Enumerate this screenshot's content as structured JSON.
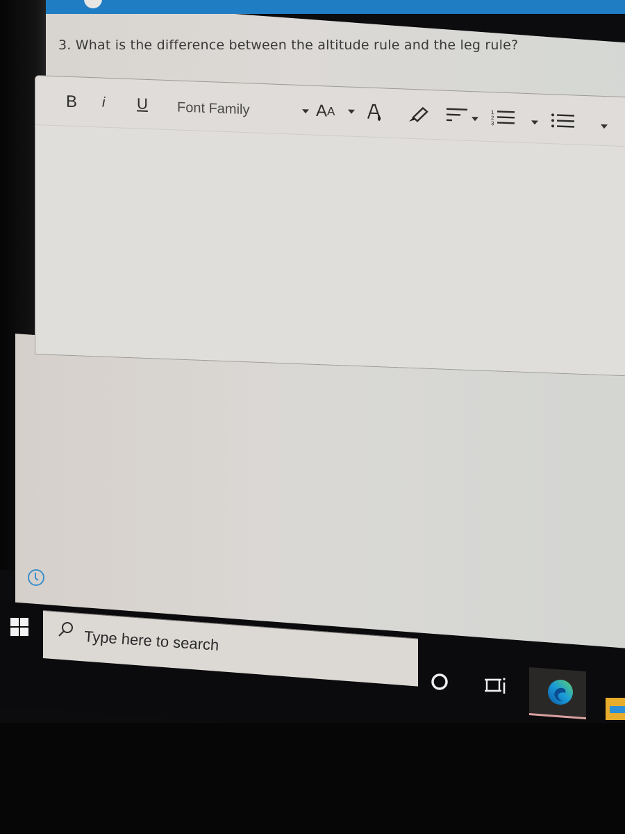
{
  "header": {
    "accent_color": "#1f7dc4"
  },
  "question": {
    "text": "3. What is the difference between the altitude rule and the leg rule?"
  },
  "editor": {
    "toolbar": {
      "bold_label": "B",
      "italic_label": "i",
      "underline_label": "U",
      "font_family_label": "Font Family",
      "font_size_label_big": "A",
      "font_size_label_small": "A",
      "font_color_icon": "font-color-icon",
      "highlight_icon": "highlighter-icon",
      "align_icon": "align-left-icon",
      "ordered_list_icon": "numbered-list-icon",
      "unordered_list_icon": "bulleted-list-icon"
    },
    "body_text": ""
  },
  "taskbar": {
    "start_icon": "windows-start-icon",
    "search_placeholder": "Type here to search",
    "cortana_icon": "cortana-icon",
    "task_view_icon": "task-view-icon",
    "pinned_apps": [
      {
        "name": "Microsoft Edge",
        "icon": "edge-icon",
        "active": true
      },
      {
        "name": "File Explorer",
        "icon": "folder-icon",
        "active": false
      }
    ]
  },
  "side_icons": {
    "history_icon": "history-clock-icon"
  }
}
